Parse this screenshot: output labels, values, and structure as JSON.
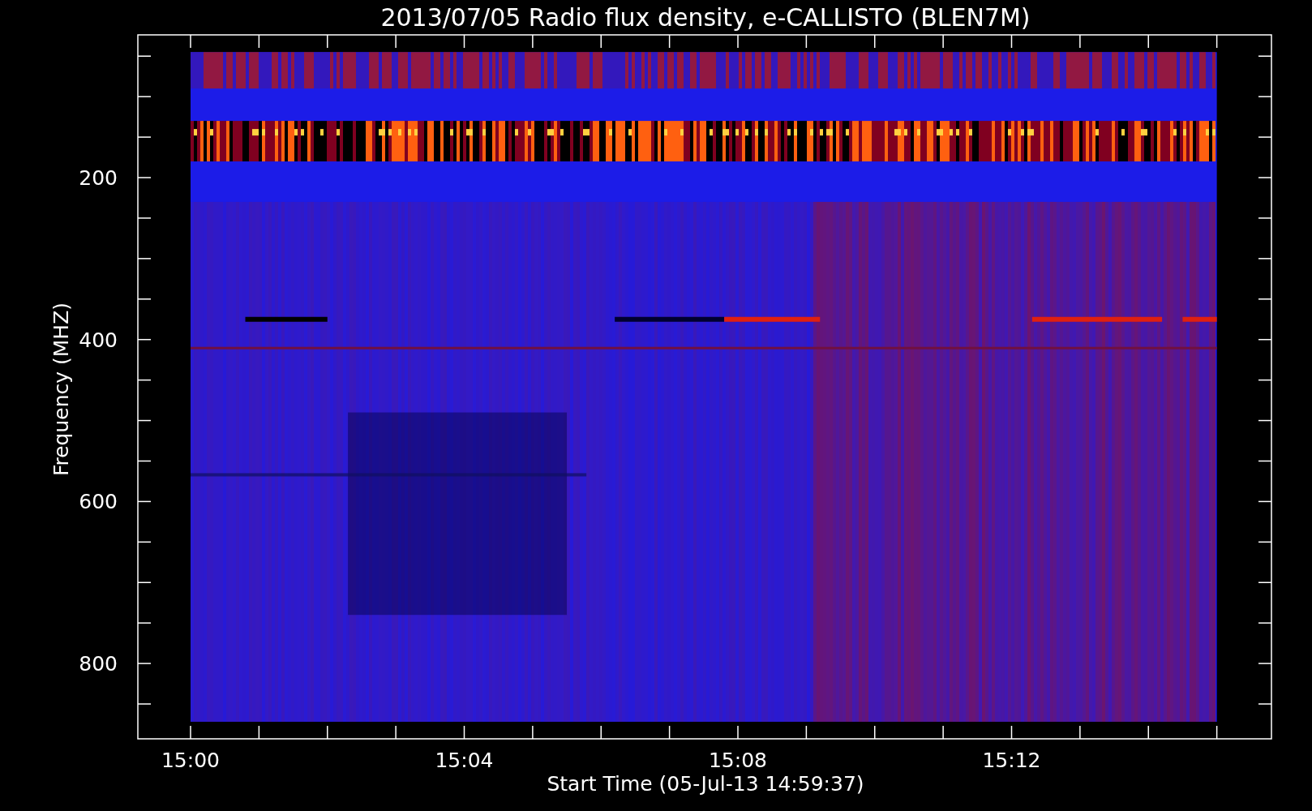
{
  "title": "2013/07/05  Radio flux density, e-CALLISTO (BLEN7M)",
  "y_axis": {
    "label": "Frequency (MHZ)",
    "ticks": [
      "200",
      "400",
      "600",
      "800"
    ]
  },
  "x_axis": {
    "label": "Start Time (05-Jul-13 14:59:37)",
    "ticks": [
      "15:00",
      "15:04",
      "15:08",
      "15:12"
    ]
  }
}
